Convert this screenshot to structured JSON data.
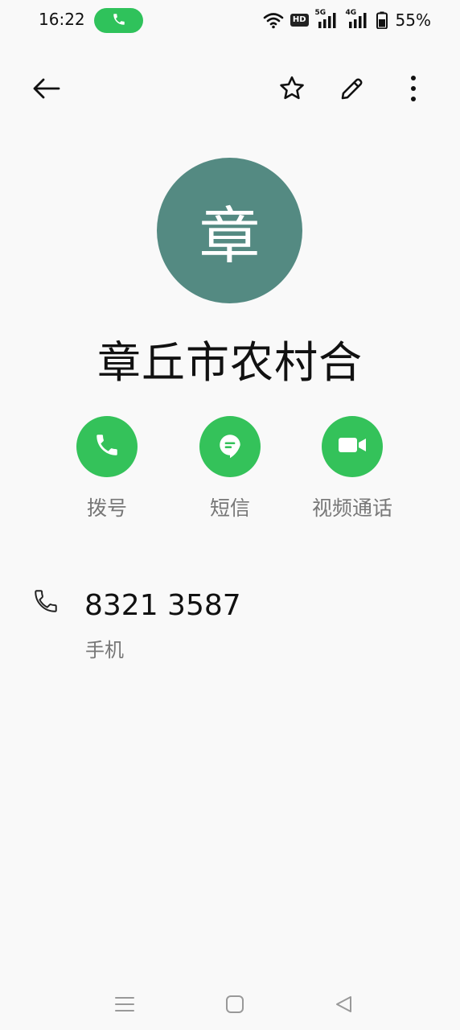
{
  "status_bar": {
    "time": "16:22",
    "call_indicator_icon": "phone-icon",
    "hd_badge": "HD",
    "network_1": "5G",
    "network_2": "4G",
    "battery_percent": "55%"
  },
  "top_bar": {
    "back_icon": "back-arrow-icon",
    "favorite_icon": "star-icon",
    "edit_icon": "pencil-icon",
    "more_icon": "more-vertical-icon"
  },
  "contact": {
    "avatar_letter": "章",
    "avatar_color": "#548a82",
    "name": "章丘市农村合"
  },
  "actions": [
    {
      "label": "拨号",
      "icon": "phone-icon"
    },
    {
      "label": "短信",
      "icon": "message-icon"
    },
    {
      "label": "视频通话",
      "icon": "video-camera-icon"
    }
  ],
  "phone": {
    "number": "8321 3587",
    "type": "手机",
    "icon": "phone-icon"
  },
  "accent_color": "#34c25a",
  "nav_bar": {
    "menu_icon": "menu-icon",
    "home_icon": "home-square-icon",
    "back_icon": "back-triangle-icon"
  }
}
